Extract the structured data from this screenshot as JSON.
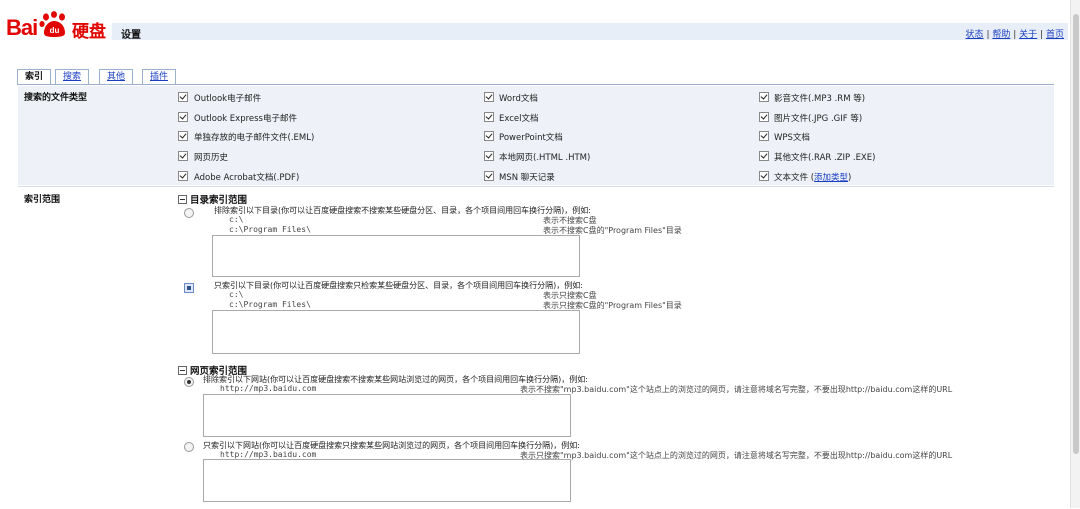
{
  "brand": {
    "part1": "Bai",
    "part2": "du",
    "part3": "硬盘"
  },
  "header": {
    "title": "设置",
    "links": [
      "状态",
      "帮助",
      "关于",
      "首页"
    ],
    "separator": "|"
  },
  "tabs": [
    {
      "label": "索引",
      "active": true
    },
    {
      "label": "搜索",
      "active": false
    },
    {
      "label": "其他",
      "active": false
    },
    {
      "label": "插件",
      "active": false
    }
  ],
  "file_types": {
    "label": "搜索的文件类型",
    "col1": [
      "Outlook电子邮件",
      "Outlook Express电子邮件",
      "单独存放的电子邮件文件(.EML)",
      "网页历史",
      "Adobe Acrobat文档(.PDF)"
    ],
    "col2": [
      "Word文档",
      "Excel文档",
      "PowerPoint文档",
      "本地网页(.HTML .HTM)",
      "MSN 聊天记录"
    ],
    "col3": [
      "影音文件(.MP3 .RM 等)",
      "图片文件(.JPG .GIF 等)",
      "WPS文档",
      "其他文件(.RAR .ZIP .EXE)",
      "文本文件 ("
    ],
    "add_type_link": "添加类型",
    "close_paren": ")"
  },
  "index_scope": {
    "label": "索引范围",
    "dir_group": {
      "title": "目录索引范围",
      "exclude_desc": "排除索引以下目录(你可以让百度硬盘搜索不搜索某些硬盘分区、目录，各个项目间用回车换行分隔)，例如:",
      "exclude_ex1": "c:\\",
      "exclude_ex1_note": "表示不搜索C盘",
      "exclude_ex2": "c:\\Program Files\\",
      "exclude_ex2_note": "表示不搜索C盘的\"Program Files\"目录",
      "only_desc": "只索引以下目录(你可以让百度硬盘搜索只检索某些硬盘分区、目录，各个项目间用回车换行分隔)，例如:",
      "only_ex1": "c:\\",
      "only_ex1_note": "表示只搜索C盘",
      "only_ex2": "c:\\Program Files\\",
      "only_ex2_note": "表示只搜索C盘的\"Program Files\"目录"
    },
    "web_group": {
      "title": "网页索引范围",
      "exclude_desc": "排除索引以下网站(你可以让百度硬盘搜索不搜索某些网站浏览过的网页，各个项目间用回车换行分隔)，例如:",
      "exclude_ex": "http://mp3.baidu.com",
      "exclude_note": "表示不搜索\"mp3.baidu.com\"这个站点上的浏览过的网页，请注意将域名写完整，不要出现http://baidu.com这样的URL",
      "only_desc": "只索引以下网站(你可以让百度硬盘搜索只搜索某些网站浏览过的网页，各个项目间用回车换行分隔)，例如:",
      "only_ex": "http://mp3.baidu.com",
      "only_note": "表示只搜索\"mp3.baidu.com\"这个站点上的浏览过的网页，请注意将域名写完整，不要出现http://baidu.com这样的URL"
    }
  },
  "colors": {
    "brand_red": "#e10602",
    "link_blue": "#1a3ec1",
    "header_bg": "#e8eef7",
    "section_bg": "#eef2f8"
  }
}
